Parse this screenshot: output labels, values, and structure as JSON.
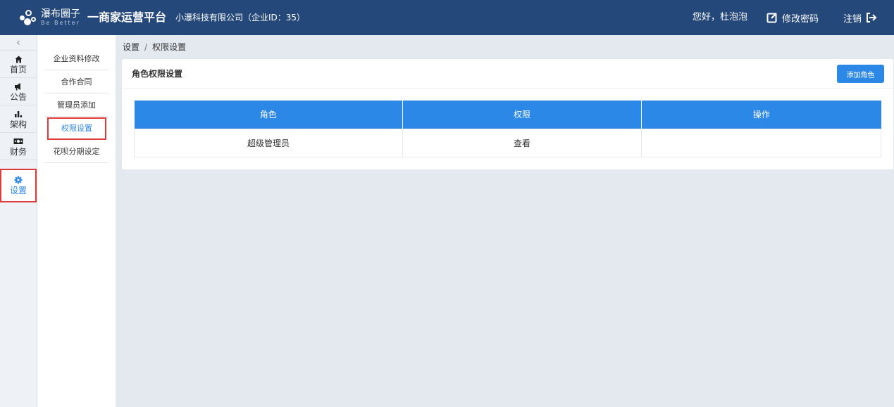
{
  "header": {
    "brand_name": "瀑布圈子",
    "brand_slogan": "Be Better",
    "platform_title": "一商家运营平台",
    "company": "小瀑科技有限公司（企业ID：35）",
    "greeting": "您好，杜泡泡",
    "change_password": "修改密码",
    "logout": "注销"
  },
  "rail": {
    "collapse_icon": "chevron-left-icon",
    "items": [
      {
        "label": "首页",
        "icon": "home-icon"
      },
      {
        "label": "公告",
        "icon": "megaphone-icon"
      },
      {
        "label": "架构",
        "icon": "bar-chart-icon"
      },
      {
        "label": "财务",
        "icon": "money-icon"
      },
      {
        "label": "设置",
        "icon": "gear-icon",
        "active": true
      }
    ]
  },
  "subnav": {
    "items": [
      {
        "label": "企业资料修改"
      },
      {
        "label": "合作合同"
      },
      {
        "label": "管理员添加"
      },
      {
        "label": "权限设置",
        "active": true
      },
      {
        "label": "花呗分期设定"
      }
    ]
  },
  "breadcrumb": {
    "root": "设置",
    "separator": "/",
    "current": "权限设置"
  },
  "card": {
    "title": "角色权限设置",
    "add_button": "添加角色"
  },
  "table": {
    "columns": [
      "角色",
      "权限",
      "操作"
    ],
    "rows": [
      [
        "超级管理员",
        "查看",
        ""
      ]
    ]
  },
  "colors": {
    "header_bg": "#24487a",
    "accent": "#2b88e6",
    "highlight_border": "#e03a3a",
    "page_bg": "#e4e9f0"
  }
}
